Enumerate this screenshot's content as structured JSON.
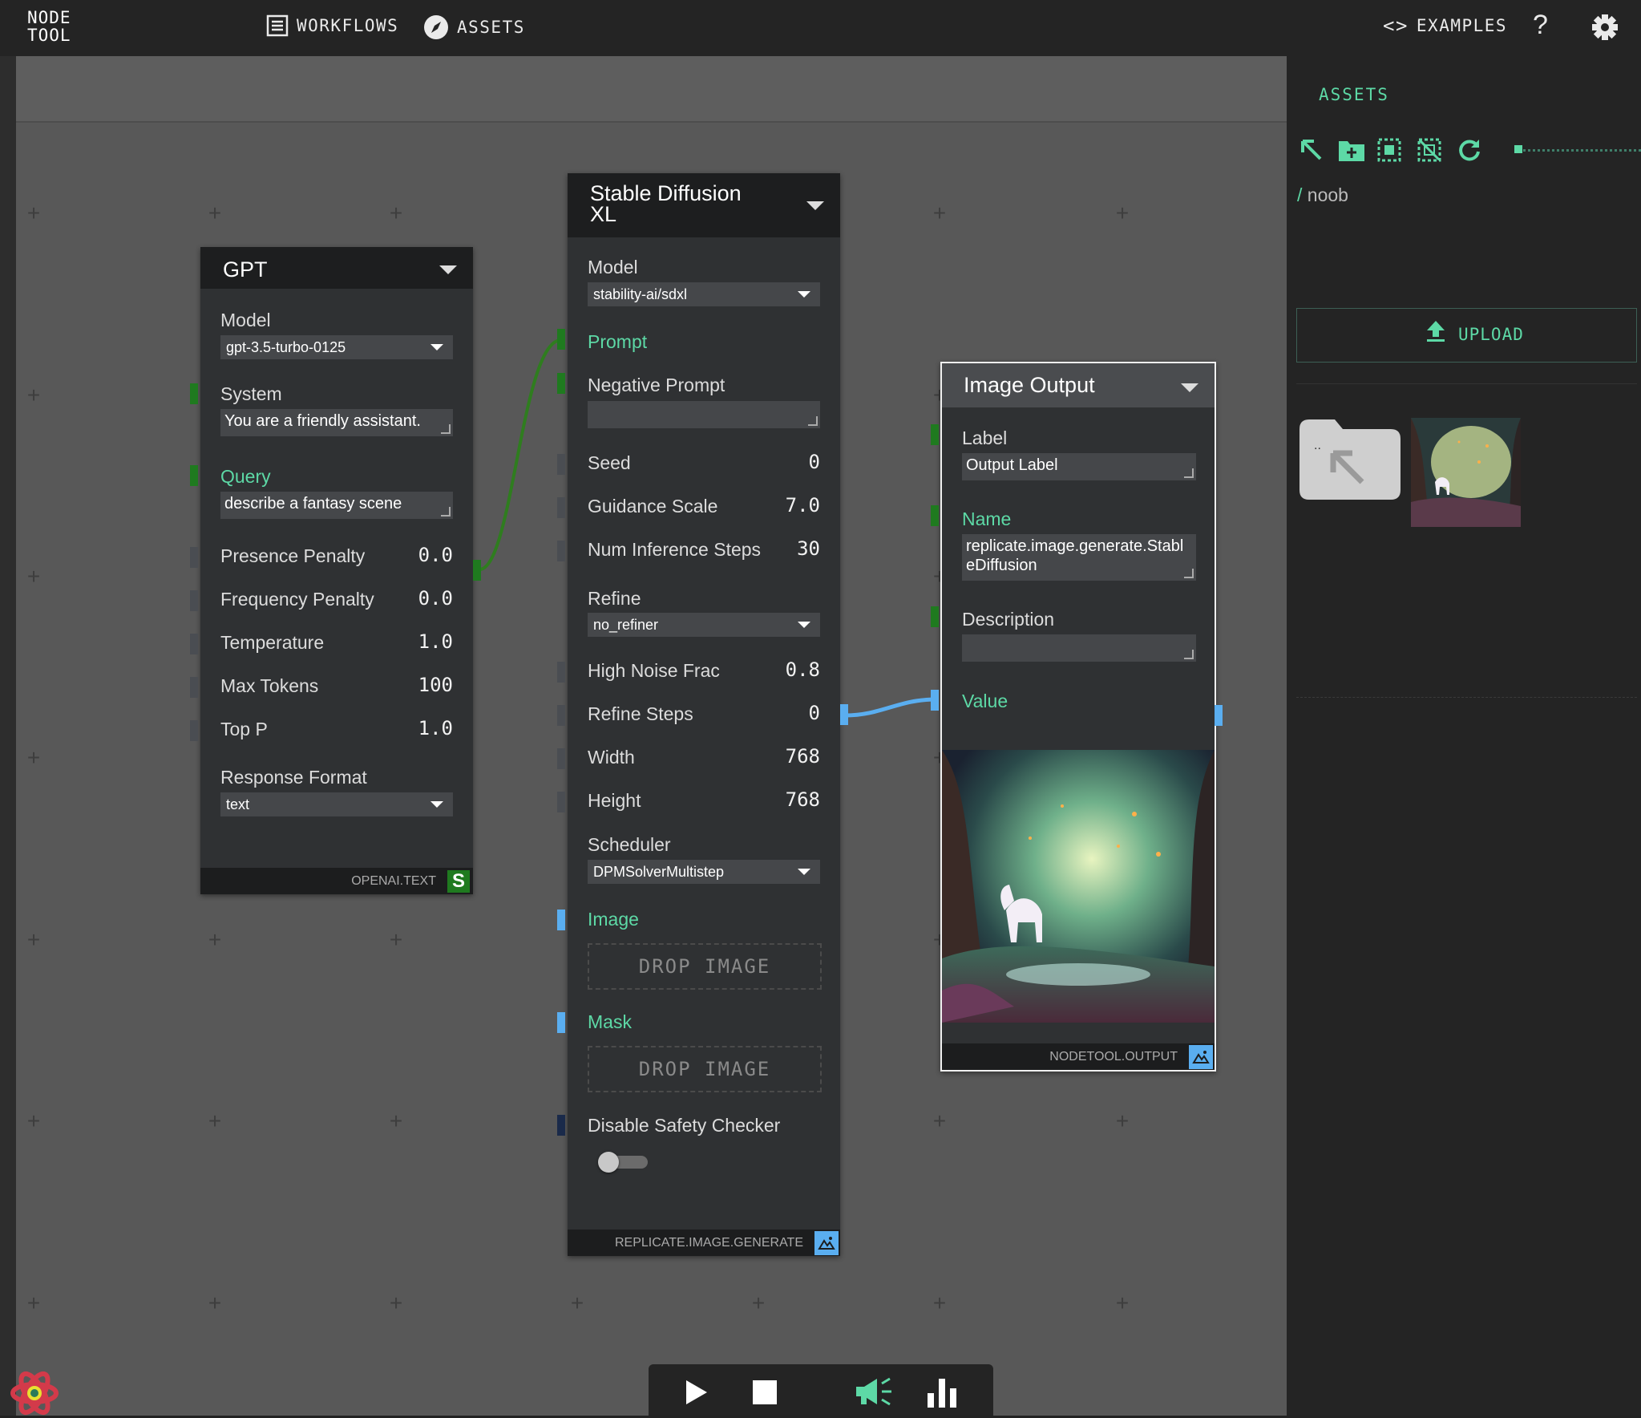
{
  "app": {
    "logo_line1": "NODE",
    "logo_line2": "TOOL"
  },
  "nav": {
    "workflows": "WORKFLOWS",
    "assets": "ASSETS",
    "examples": "EXAMPLES",
    "help": "?"
  },
  "gpt": {
    "title": "GPT",
    "model_label": "Model",
    "model_value": "gpt-3.5-turbo-0125",
    "system_label": "System",
    "system_value": "You are a friendly assistant.",
    "query_label": "Query",
    "query_value": "describe a fantasy scene",
    "params": [
      {
        "label": "Presence Penalty",
        "value": "0.0"
      },
      {
        "label": "Frequency Penalty",
        "value": "0.0"
      },
      {
        "label": "Temperature",
        "value": "1.0"
      },
      {
        "label": "Max Tokens",
        "value": "100"
      },
      {
        "label": "Top P",
        "value": "1.0"
      }
    ],
    "response_format_label": "Response Format",
    "response_format_value": "text",
    "footer": "OPENAI.TEXT",
    "badge": "S"
  },
  "sdxl": {
    "title_line1": "Stable Diffusion",
    "title_line2": "XL",
    "model_label": "Model",
    "model_value": "stability-ai/sdxl",
    "prompt_label": "Prompt",
    "negative_prompt_label": "Negative Prompt",
    "negative_prompt_value": "",
    "params": [
      {
        "label": "Seed",
        "value": "0"
      },
      {
        "label": "Guidance Scale",
        "value": "7.0"
      },
      {
        "label": "Num Inference Steps",
        "value": "30"
      }
    ],
    "refine_label": "Refine",
    "refine_value": "no_refiner",
    "params2": [
      {
        "label": "High Noise Frac",
        "value": "0.8"
      },
      {
        "label": "Refine Steps",
        "value": "0"
      },
      {
        "label": "Width",
        "value": "768"
      },
      {
        "label": "Height",
        "value": "768"
      }
    ],
    "scheduler_label": "Scheduler",
    "scheduler_value": "DPMSolverMultistep",
    "image_label": "Image",
    "image_drop": "DROP IMAGE",
    "mask_label": "Mask",
    "mask_drop": "DROP IMAGE",
    "safety_label": "Disable Safety Checker",
    "safety_on": false,
    "footer": "REPLICATE.IMAGE.GENERATE"
  },
  "output": {
    "title": "Image Output",
    "label_label": "Label",
    "label_value": "Output Label",
    "name_label": "Name",
    "name_value": "replicate.image.generate.StableDiffusion",
    "description_label": "Description",
    "description_value": "",
    "value_label": "Value",
    "footer": "NODETOOL.OUTPUT"
  },
  "sidebar": {
    "title": "ASSETS",
    "path_sep": "/",
    "path": "noob",
    "upload": "UPLOAD",
    "parent_folder_label": ".."
  },
  "colors": {
    "accent": "#5dd9a6",
    "canvas": "#585858",
    "node": "#2f3133",
    "edge_text": "#2f7d1f",
    "edge_image": "#5aaef0"
  }
}
